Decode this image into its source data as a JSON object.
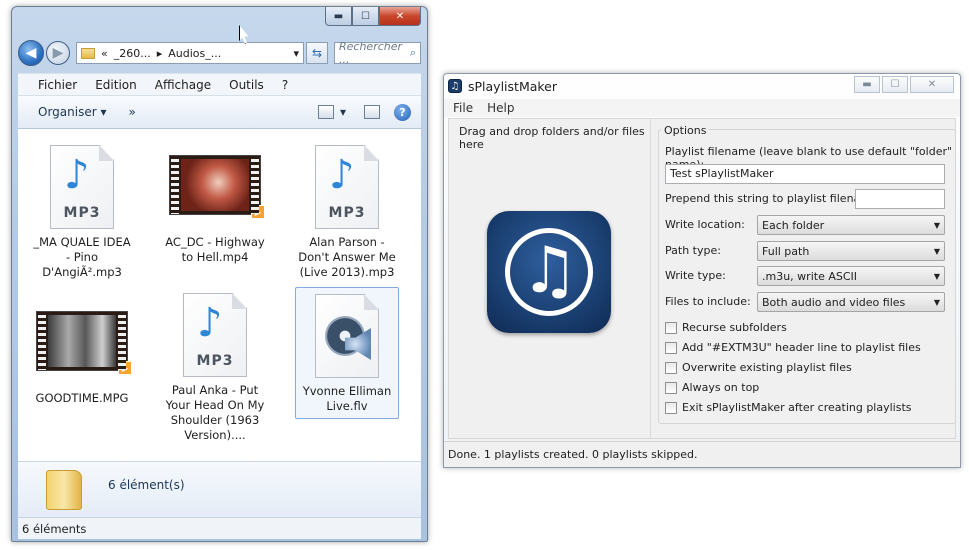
{
  "explorer": {
    "caption_buttons": {
      "minimize": "▬",
      "maximize": "☐",
      "close": "✕"
    },
    "nav": {
      "back": "◀",
      "forward": "▶"
    },
    "address": {
      "prefix": "«",
      "segment1": "_260...",
      "separator": "▸",
      "segment2": "Audios_...",
      "dropdown": "▾"
    },
    "refresh": "⇆",
    "search": {
      "placeholder": "Rechercher ...",
      "icon": "search-icon"
    },
    "menu": [
      "Fichier",
      "Edition",
      "Affichage",
      "Outils",
      "?"
    ],
    "commands": {
      "organize": "Organiser ▾",
      "more": "»",
      "view_arrow": "▾",
      "help": "?"
    },
    "files": [
      {
        "name": "_MA QUALE IDEA - Pino D'AngiÃ².mp3",
        "type": "mp3",
        "badge": "MP3"
      },
      {
        "name": "AC_DC - Highway to Hell.mp4",
        "type": "video"
      },
      {
        "name": "Alan Parson - Don't Answer Me (Live 2013).mp3",
        "type": "mp3",
        "badge": "MP3"
      },
      {
        "name": "GOODTIME.MPG",
        "type": "video"
      },
      {
        "name": "Paul Anka - Put Your Head On My Shoulder (1963 Version)....",
        "type": "mp3",
        "badge": "MP3"
      },
      {
        "name": "Yvonne Elliman Live.flv",
        "type": "flv"
      }
    ],
    "details": {
      "count": "6 élément(s)"
    },
    "status": "6 éléments"
  },
  "spm": {
    "title": "sPlaylistMaker",
    "title_buttons": {
      "minimize": "▬",
      "maximize": "☐",
      "close": "✕"
    },
    "menu": [
      "File",
      "Help"
    ],
    "drop_label": "Drag and drop folders and/or files here",
    "options_legend": "Options",
    "playlist_filename_label": "Playlist filename (leave blank to use default \"folder\" name):",
    "playlist_filename_value": "Test sPlaylistMaker",
    "prepend_label": "Prepend this string to playlist filenames:",
    "prepend_value": "",
    "write_location_label": "Write location:",
    "write_location_value": "Each folder",
    "path_type_label": "Path type:",
    "path_type_value": "Full path",
    "write_type_label": "Write type:",
    "write_type_value": ".m3u, write ASCII",
    "files_include_label": "Files to include:",
    "files_include_value": "Both audio and video files",
    "checkboxes": [
      "Recurse subfolders",
      "Add \"#EXTM3U\" header line to playlist files",
      "Overwrite existing playlist files",
      "Always on top",
      "Exit sPlaylistMaker after creating playlists"
    ],
    "status": "Done.  1 playlists created.  0 playlists skipped."
  }
}
